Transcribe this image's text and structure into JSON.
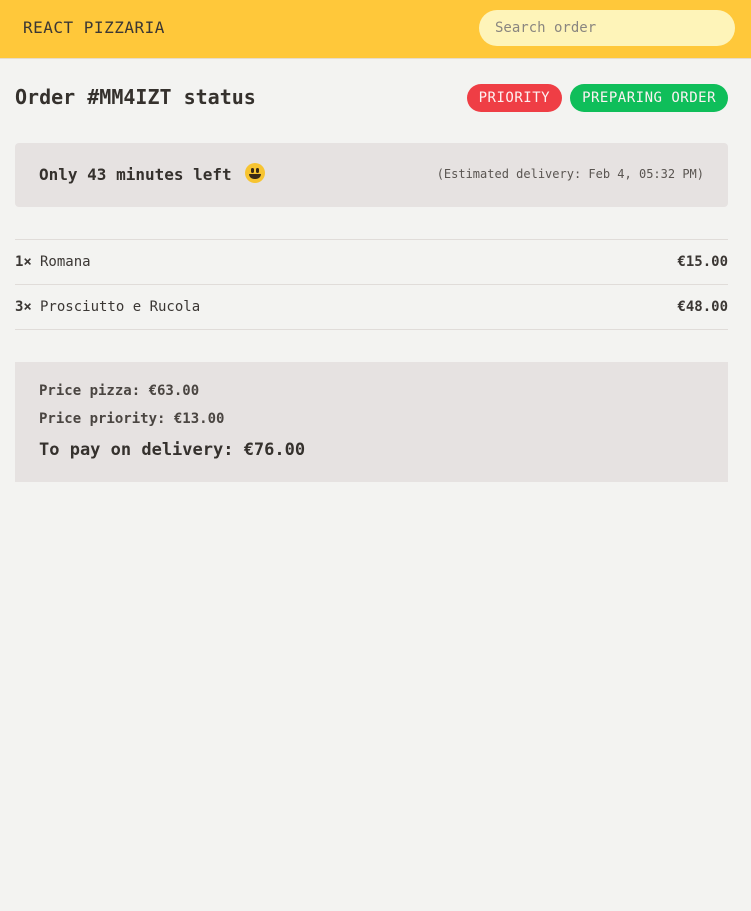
{
  "header": {
    "brand": "REACT PIZZARIA",
    "search_placeholder": "Search order",
    "search_value": ""
  },
  "order": {
    "title": "Order #MM4IZT status",
    "badges": {
      "priority": "PRIORITY",
      "status": "PREPARING ORDER"
    },
    "countdown": {
      "text": "Only 43 minutes left",
      "emoji_icon": "grinning-face-icon",
      "estimated": "(Estimated delivery: Feb 4, 05:32 PM)"
    },
    "items": [
      {
        "qty": "1×",
        "name": "Romana",
        "price": "€15.00"
      },
      {
        "qty": "3×",
        "name": "Prosciutto e Rucola",
        "price": "€48.00"
      }
    ],
    "summary": {
      "price_pizza": "Price pizza: €63.00",
      "price_priority": "Price priority: €13.00",
      "to_pay": "To pay on delivery: €76.00"
    }
  },
  "colors": {
    "header_bg": "#ffc83a",
    "search_bg": "#fef4b9",
    "priority_badge": "#ef3e45",
    "status_badge": "#0fbe5a",
    "panel_bg": "#e6e2e1",
    "page_bg": "#f3f3f1"
  }
}
